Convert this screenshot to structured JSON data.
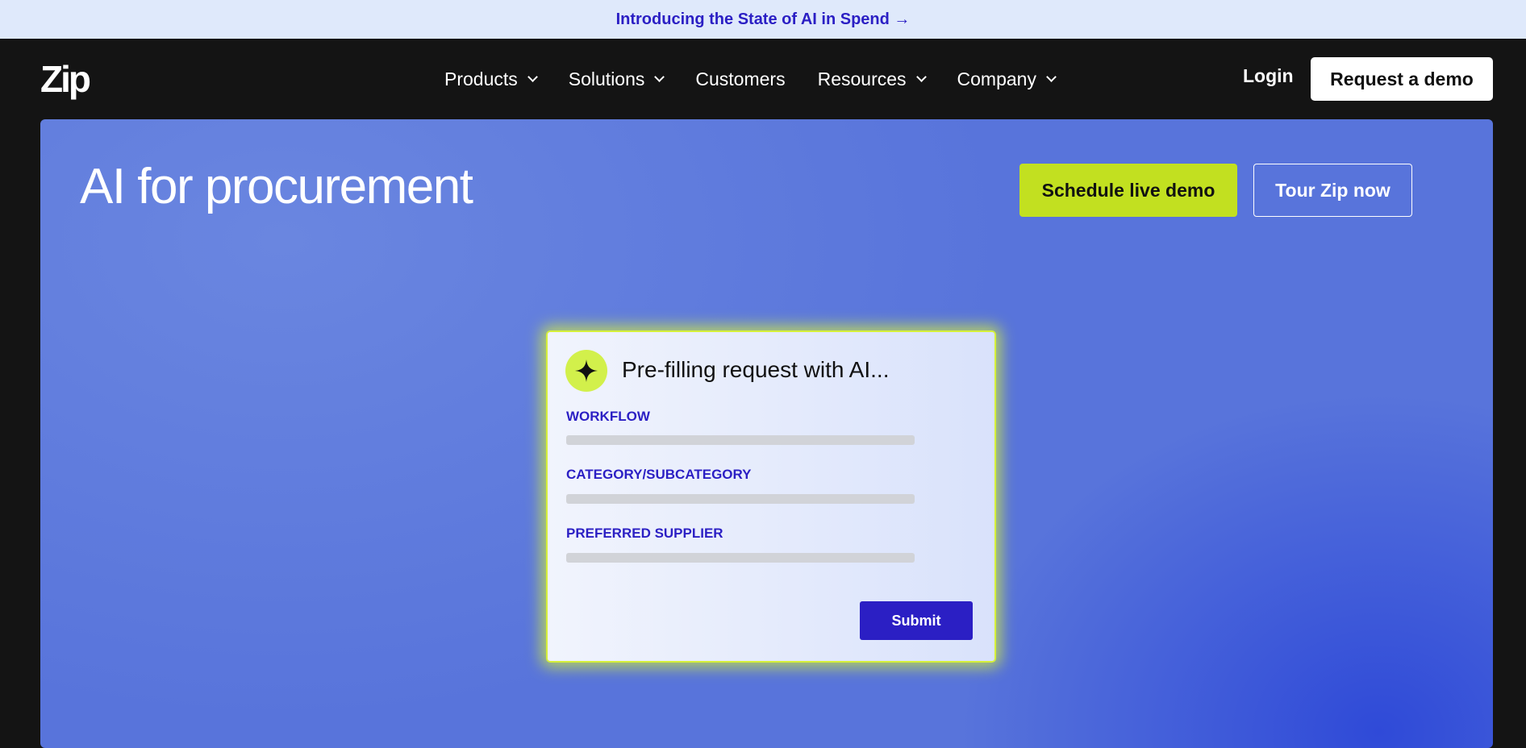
{
  "announcement": {
    "text": "Introducing the State of AI in Spend →"
  },
  "nav": {
    "logo": "Zip",
    "items": [
      {
        "label": "Products",
        "has_menu": true
      },
      {
        "label": "Solutions",
        "has_menu": true
      },
      {
        "label": "Customers",
        "has_menu": false
      },
      {
        "label": "Resources",
        "has_menu": true
      },
      {
        "label": "Company",
        "has_menu": true
      }
    ],
    "login": "Login",
    "request_demo": "Request a demo"
  },
  "hero": {
    "title": "AI for procurement",
    "primary_cta": "Schedule live demo",
    "secondary_cta": "Tour Zip now"
  },
  "card": {
    "icon": "sparkle-icon",
    "title": "Pre-filling request with AI...",
    "fields": [
      {
        "label": "WORKFLOW"
      },
      {
        "label": "CATEGORY/SUBCATEGORY"
      },
      {
        "label": "PREFERRED SUPPLIER"
      }
    ],
    "submit": "Submit"
  },
  "colors": {
    "accent_lime": "#c2e020",
    "brand_indigo": "#2b1fc4",
    "hero_blue": "#5874db",
    "nav_bg": "#141414"
  }
}
